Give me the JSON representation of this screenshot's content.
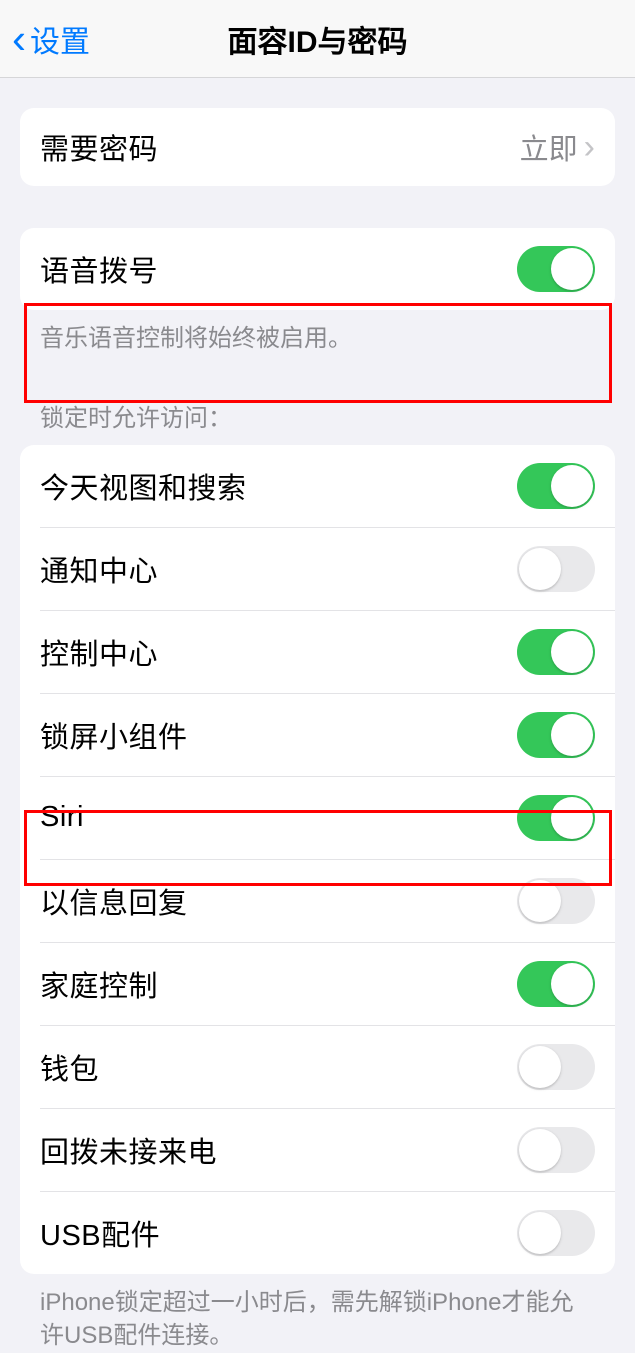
{
  "header": {
    "back_label": "设置",
    "title": "面容ID与密码"
  },
  "require_passcode": {
    "label": "需要密码",
    "value": "立即"
  },
  "voice_dial": {
    "label": "语音拨号",
    "on": true,
    "footer": "音乐语音控制将始终被启用。"
  },
  "lock_section_header": "锁定时允许访问：",
  "lock_items": [
    {
      "label": "今天视图和搜索",
      "on": true
    },
    {
      "label": "通知中心",
      "on": false
    },
    {
      "label": "控制中心",
      "on": true
    },
    {
      "label": "锁屏小组件",
      "on": true
    },
    {
      "label": "Siri",
      "on": true
    },
    {
      "label": "以信息回复",
      "on": false
    },
    {
      "label": "家庭控制",
      "on": true
    },
    {
      "label": "钱包",
      "on": false
    },
    {
      "label": "回拨未接来电",
      "on": false
    },
    {
      "label": "USB配件",
      "on": false
    }
  ],
  "usb_footer": "iPhone锁定超过一小时后，需先解锁iPhone才能允许USB配件连接。"
}
